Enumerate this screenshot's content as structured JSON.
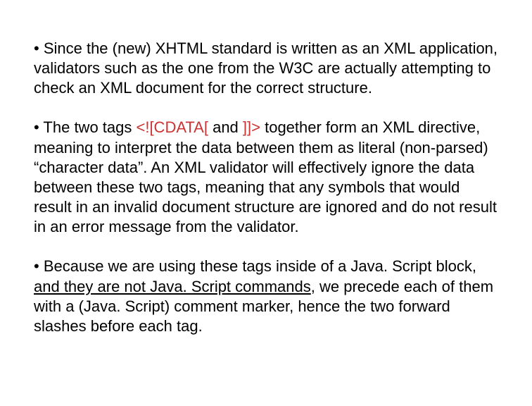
{
  "para1": {
    "text": "• Since the (new) XHTML standard is written as an XML application, validators such as the one from the W3C are actually attempting to check an XML document for the correct structure."
  },
  "para2": {
    "t1": "• The two tags  ",
    "cdata_open": "<![CDATA[",
    "t2": "  and  ",
    "cdata_close": "]]>",
    "t3": "  together form an XML directive, meaning to interpret the data between them as literal (non-parsed) “character data”.  An XML validator will effectively ignore the data between these two tags, meaning that any symbols that would result in an invalid document structure are ignored and do not result in an error message from the validator."
  },
  "para3": {
    "t1": "• Because we are using these tags inside of a Java. Script block, ",
    "ul": "and they are not Java. Script commands",
    "t2": ", we precede each of them with a  (Java. Script) comment marker, hence the two forward slashes before each tag."
  }
}
